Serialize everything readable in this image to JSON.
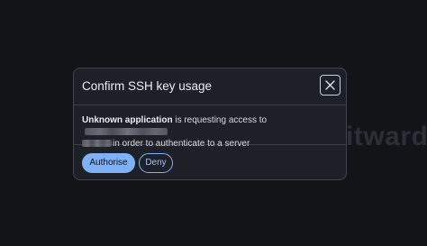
{
  "background": {
    "logo_fragment": "itward",
    "color": "#131418"
  },
  "dialog": {
    "title": "Confirm SSH key usage",
    "close_icon": "close-icon",
    "message": {
      "app_name": "Unknown application",
      "text_before_host": "is requesting access to",
      "text_after_host": "in order to authenticate to a server"
    },
    "buttons": {
      "authorise_label": "Authorise",
      "deny_label": "Deny"
    }
  },
  "colors": {
    "accent": "#7eb1f5",
    "dialog_bg": "#1e2028",
    "border": "#41444f"
  }
}
